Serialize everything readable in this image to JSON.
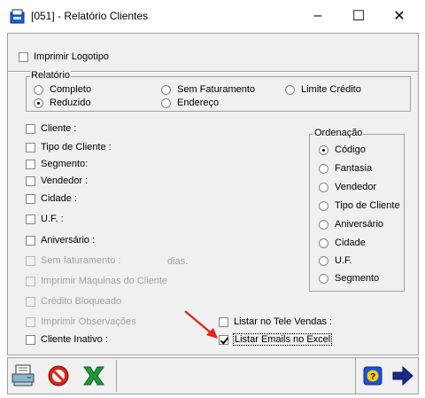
{
  "window": {
    "title": "[051] - Relatório Clientes",
    "minimize_glyph": "–",
    "maximize_glyph": "☐",
    "close_glyph": "✕"
  },
  "options": {
    "imprimir_logotipo": "Imprimir Logotipo"
  },
  "relatorio": {
    "title": "Relatório",
    "options": [
      "Completo",
      "Sem Faturamento",
      "Limite Crédito",
      "Reduzido",
      "Endereço"
    ],
    "selected": "Reduzido"
  },
  "filters": {
    "cliente": "Cliente :",
    "tipo_cliente": "Tipo de Cliente :",
    "segmento": "Segmento:",
    "vendedor": "Vendedor :",
    "cidade": "Cidade :",
    "uf": "U.F. :",
    "aniversario": "Aniversário :",
    "sem_faturamento": "Sem faturamento :",
    "dias": "dias.",
    "imprimir_maquinas": "Imprimir Máquinas do Cliente",
    "credito_bloqueado": "Crédito Bloqueado",
    "imprimir_observacoes": "Imprimir Observações",
    "cliente_inativo": "Cliente Inativo :",
    "listar_tele_vendas": "Listar no Tele Vendas :",
    "listar_emails_excel": "Listar Emails no Excel",
    "listar_emails_excel_checked": true
  },
  "ordenacao": {
    "title": "Ordenação",
    "options": [
      "Código",
      "Fantasia",
      "Vendedor",
      "Tipo de Cliente",
      "Aniversário",
      "Cidade",
      "U.F.",
      "Segmento"
    ],
    "selected": "Código"
  },
  "toolbar": {
    "icons": [
      "printer-icon",
      "cancel-icon",
      "excel-icon",
      "help-icon",
      "next-arrow-icon"
    ]
  },
  "colors": {
    "dialog_bg": "#f0f0f0",
    "annotation_arrow": "#e8201c",
    "excel_green": "#1f9a3a",
    "next_arrow": "#1a2a8c"
  }
}
